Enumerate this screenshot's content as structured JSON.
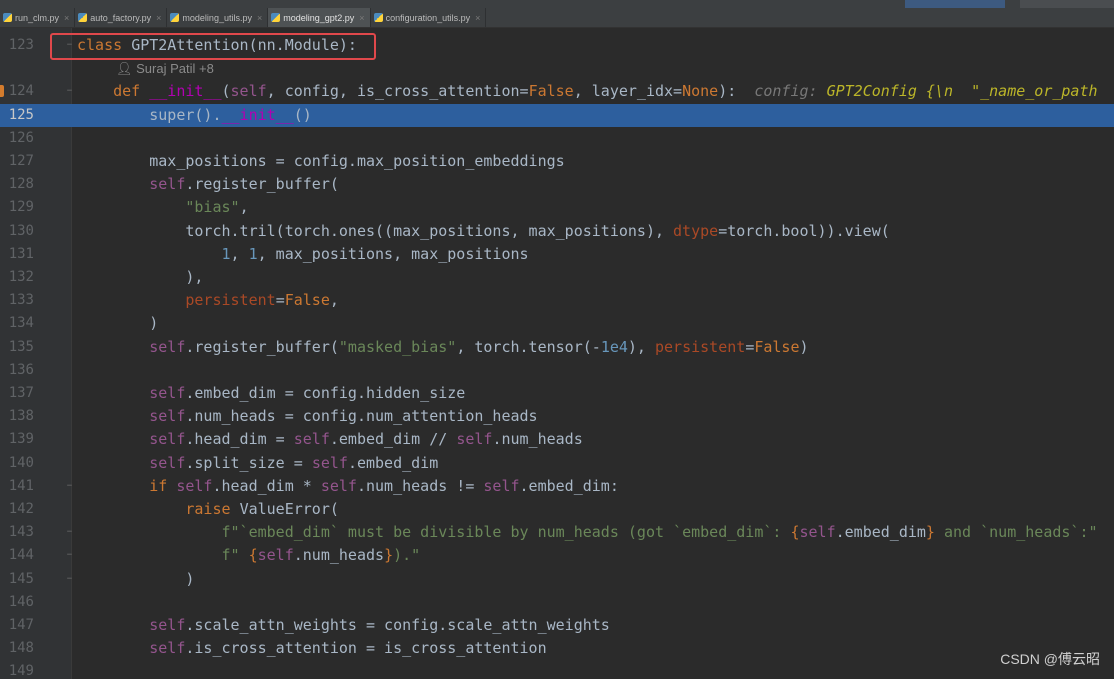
{
  "tabs": [
    {
      "label": "run_clm.py",
      "active": false
    },
    {
      "label": "auto_factory.py",
      "active": false
    },
    {
      "label": "modeling_utils.py",
      "active": false
    },
    {
      "label": "modeling_gpt2.py",
      "active": true
    },
    {
      "label": "configuration_utils.py",
      "active": false
    }
  ],
  "editor": {
    "author_hint": "Suraj Patil +8",
    "current_line": "125",
    "lines": [
      {
        "n": "123",
        "fold": "−",
        "tokens": [
          [
            "kw",
            "class "
          ],
          [
            "txt",
            "GPT2Attention(nn.Module):"
          ]
        ]
      },
      {
        "n": "124",
        "fold": "−",
        "tokens": [
          [
            "txt",
            "    "
          ],
          [
            "kw",
            "def "
          ],
          [
            "dunder",
            "__init__"
          ],
          [
            "txt",
            "("
          ],
          [
            "self",
            "self"
          ],
          [
            "txt",
            ", config, is_cross_attention="
          ],
          [
            "kw",
            "False"
          ],
          [
            "txt",
            ", layer_idx="
          ],
          [
            "kw",
            "None"
          ],
          [
            "txt",
            "):  "
          ],
          [
            "hint",
            "config: "
          ],
          [
            "hint-type",
            "GPT2Config {\\n  \"_name_or_path"
          ]
        ]
      },
      {
        "n": "125",
        "fold": "",
        "tokens": [
          [
            "txt",
            "        super()."
          ],
          [
            "dunder",
            "__init__"
          ],
          [
            "txt",
            "()"
          ]
        ]
      },
      {
        "n": "126",
        "fold": "",
        "tokens": []
      },
      {
        "n": "127",
        "fold": "",
        "tokens": [
          [
            "txt",
            "        max_positions = config.max_position_embeddings"
          ]
        ]
      },
      {
        "n": "128",
        "fold": "",
        "tokens": [
          [
            "txt",
            "        "
          ],
          [
            "self",
            "self"
          ],
          [
            "txt",
            ".register_buffer("
          ]
        ]
      },
      {
        "n": "129",
        "fold": "",
        "tokens": [
          [
            "txt",
            "            "
          ],
          [
            "str",
            "\"bias\""
          ],
          [
            "txt",
            ","
          ]
        ]
      },
      {
        "n": "130",
        "fold": "",
        "tokens": [
          [
            "txt",
            "            torch.tril(torch.ones((max_positions, max_positions), "
          ],
          [
            "param",
            "dtype"
          ],
          [
            "txt",
            "=torch.bool)).view("
          ]
        ]
      },
      {
        "n": "131",
        "fold": "",
        "tokens": [
          [
            "txt",
            "                "
          ],
          [
            "num-lit",
            "1"
          ],
          [
            "txt",
            ", "
          ],
          [
            "num-lit",
            "1"
          ],
          [
            "txt",
            ", max_positions, max_positions"
          ]
        ]
      },
      {
        "n": "132",
        "fold": "",
        "tokens": [
          [
            "txt",
            "            ),"
          ]
        ]
      },
      {
        "n": "133",
        "fold": "",
        "tokens": [
          [
            "txt",
            "            "
          ],
          [
            "param",
            "persistent"
          ],
          [
            "txt",
            "="
          ],
          [
            "kw",
            "False"
          ],
          [
            "txt",
            ","
          ]
        ]
      },
      {
        "n": "134",
        "fold": "",
        "tokens": [
          [
            "txt",
            "        )"
          ]
        ]
      },
      {
        "n": "135",
        "fold": "",
        "tokens": [
          [
            "txt",
            "        "
          ],
          [
            "self",
            "self"
          ],
          [
            "txt",
            ".register_buffer("
          ],
          [
            "str",
            "\"masked_bias\""
          ],
          [
            "txt",
            ", torch.tensor(-"
          ],
          [
            "num-lit",
            "1e4"
          ],
          [
            "txt",
            "), "
          ],
          [
            "param",
            "persistent"
          ],
          [
            "txt",
            "="
          ],
          [
            "kw",
            "False"
          ],
          [
            "txt",
            ")"
          ]
        ]
      },
      {
        "n": "136",
        "fold": "",
        "tokens": []
      },
      {
        "n": "137",
        "fold": "",
        "tokens": [
          [
            "txt",
            "        "
          ],
          [
            "self",
            "self"
          ],
          [
            "txt",
            ".embed_dim = config.hidden_size"
          ]
        ]
      },
      {
        "n": "138",
        "fold": "",
        "tokens": [
          [
            "txt",
            "        "
          ],
          [
            "self",
            "self"
          ],
          [
            "txt",
            ".num_heads = config.num_attention_heads"
          ]
        ]
      },
      {
        "n": "139",
        "fold": "",
        "tokens": [
          [
            "txt",
            "        "
          ],
          [
            "self",
            "self"
          ],
          [
            "txt",
            ".head_dim = "
          ],
          [
            "self",
            "self"
          ],
          [
            "txt",
            ".embed_dim // "
          ],
          [
            "self",
            "self"
          ],
          [
            "txt",
            ".num_heads"
          ]
        ]
      },
      {
        "n": "140",
        "fold": "",
        "tokens": [
          [
            "txt",
            "        "
          ],
          [
            "self",
            "self"
          ],
          [
            "txt",
            ".split_size = "
          ],
          [
            "self",
            "self"
          ],
          [
            "txt",
            ".embed_dim"
          ]
        ]
      },
      {
        "n": "141",
        "fold": "−",
        "tokens": [
          [
            "txt",
            "        "
          ],
          [
            "kw",
            "if "
          ],
          [
            "self",
            "self"
          ],
          [
            "txt",
            ".head_dim * "
          ],
          [
            "self",
            "self"
          ],
          [
            "txt",
            ".num_heads != "
          ],
          [
            "self",
            "self"
          ],
          [
            "txt",
            ".embed_dim:"
          ]
        ]
      },
      {
        "n": "142",
        "fold": "",
        "tokens": [
          [
            "txt",
            "            "
          ],
          [
            "kw",
            "raise "
          ],
          [
            "txt",
            "ValueError("
          ]
        ]
      },
      {
        "n": "143",
        "fold": "−",
        "tokens": [
          [
            "txt",
            "                "
          ],
          [
            "str",
            "f\"`embed_dim` must be divisible by num_heads (got `embed_dim`: "
          ],
          [
            "kw",
            "{"
          ],
          [
            "self",
            "self"
          ],
          [
            "txt",
            ".embed_dim"
          ],
          [
            "kw",
            "}"
          ],
          [
            "str",
            " and `num_heads`:\""
          ]
        ]
      },
      {
        "n": "144",
        "fold": "−",
        "tokens": [
          [
            "txt",
            "                "
          ],
          [
            "str",
            "f\" "
          ],
          [
            "kw",
            "{"
          ],
          [
            "self",
            "self"
          ],
          [
            "txt",
            ".num_heads"
          ],
          [
            "kw",
            "}"
          ],
          [
            "str",
            ").\""
          ]
        ]
      },
      {
        "n": "145",
        "fold": "−",
        "tokens": [
          [
            "txt",
            "            )"
          ]
        ]
      },
      {
        "n": "146",
        "fold": "",
        "tokens": []
      },
      {
        "n": "147",
        "fold": "",
        "tokens": [
          [
            "txt",
            "        "
          ],
          [
            "self",
            "self"
          ],
          [
            "txt",
            ".scale_attn_weights = config.scale_attn_weights"
          ]
        ]
      },
      {
        "n": "148",
        "fold": "",
        "tokens": [
          [
            "txt",
            "        "
          ],
          [
            "self",
            "self"
          ],
          [
            "txt",
            ".is_cross_attention = is_cross_attention"
          ]
        ]
      },
      {
        "n": "149",
        "fold": "",
        "tokens": []
      }
    ]
  },
  "watermark": "CSDN @傅云昭"
}
